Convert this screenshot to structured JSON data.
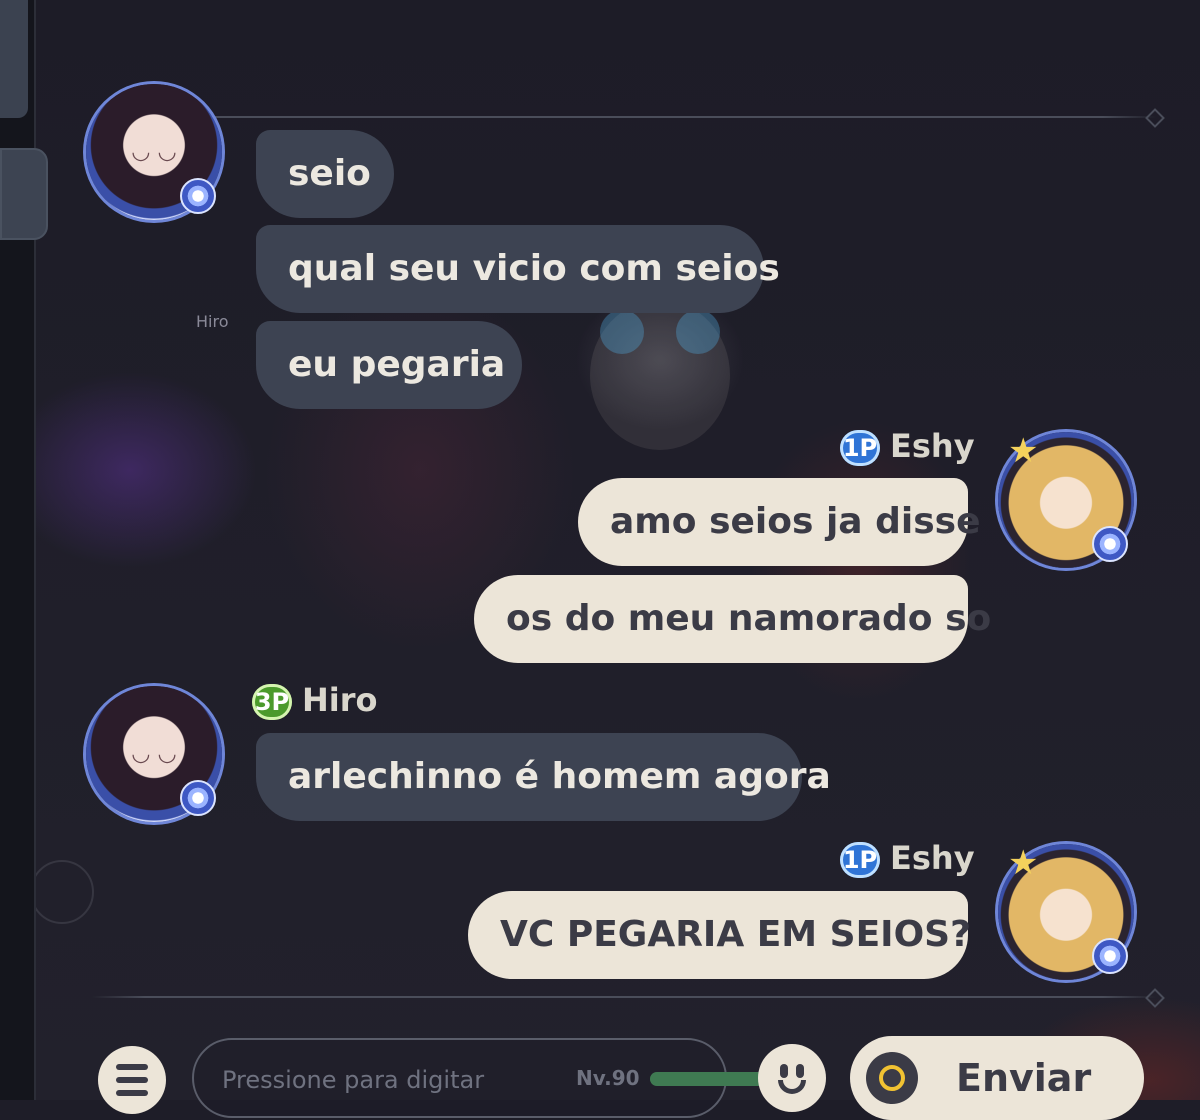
{
  "floating_name": "Hiro",
  "messages": [
    {
      "text": "seio"
    },
    {
      "text": "qual seu vicio com seios"
    },
    {
      "text": "eu pegaria"
    },
    {
      "sender": "Eshy",
      "tag": "1P"
    },
    {
      "text": "amo seios ja disse"
    },
    {
      "text": "os do meu namorado so"
    },
    {
      "sender": "Hiro",
      "tag": "3P"
    },
    {
      "text": "arlechinno é homem agora"
    },
    {
      "sender": "Eshy",
      "tag": "1P"
    },
    {
      "text": "VC PEGARIA EM SEIOS?"
    }
  ],
  "input": {
    "placeholder": "Pressione para digitar"
  },
  "status": {
    "level": "Nv.90",
    "progress": 0.85
  },
  "send_button": {
    "label": "Enviar"
  },
  "icons": {
    "menu": "list-icon",
    "emoji": "smiley-icon",
    "send": "send-ring-icon"
  },
  "colors": {
    "their_bubble": "#3d4352",
    "my_bubble": "#ece5d8",
    "background": "#1e1d28"
  }
}
